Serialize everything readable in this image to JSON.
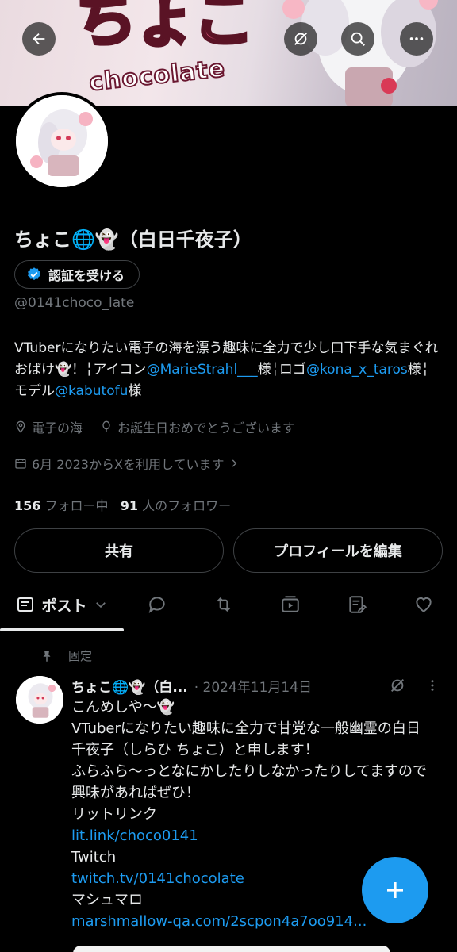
{
  "profile": {
    "name": "ちょこ🌐👻（白日千夜子）",
    "verify_label": "認証を受ける",
    "handle": "@0141choco_late",
    "bio": {
      "t1": "VTuberになりたい電子の海を漂う趣味に全力で少し口下手な気まぐれおばけ👻！╎アイコン",
      "l1": "@MarieStrahl___",
      "t2": "様╎ロゴ",
      "l2": "@kona_x_taros",
      "t3": "様╎モデル",
      "l3": "@kabutofu",
      "t4": "様"
    },
    "location": "電子の海",
    "birthday": "お誕生日おめでとうございます",
    "joined": "6月 2023からXを利用しています",
    "following_count": "156",
    "following_label": "フォロー中",
    "followers_count": "91",
    "followers_label": "人のフォロワー",
    "share_label": "共有",
    "edit_label": "プロフィールを編集"
  },
  "banner": {
    "logo_text": "ちょこ",
    "sub_text": "chocolate"
  },
  "tabs": {
    "posts_label": "ポスト"
  },
  "post": {
    "pinned_label": "固定",
    "author": "ちょこ🌐👻（白...",
    "date": "· 2024年11月14日",
    "lines": {
      "l1": "こんめしや〜👻",
      "l2": "VTuberになりたい趣味に全力で甘党な一般幽霊の白日 千夜子（しらひ ちょこ）と申します！",
      "l3": "ふらふら〜っとなにかしたりしなかったりしてますので興味があればぜひ！",
      "l4": "リットリンク",
      "l5": "lit.link/choco0141",
      "l6": "Twitch",
      "l7": "twitch.tv/0141chocolate",
      "l8": "マシュマロ",
      "l9": "marshmallow-qa.com/2scpon4a7oo914..."
    }
  },
  "colors": {
    "accent": "#1d9bf0",
    "background": "#000000",
    "secondary_text": "#71767b"
  }
}
